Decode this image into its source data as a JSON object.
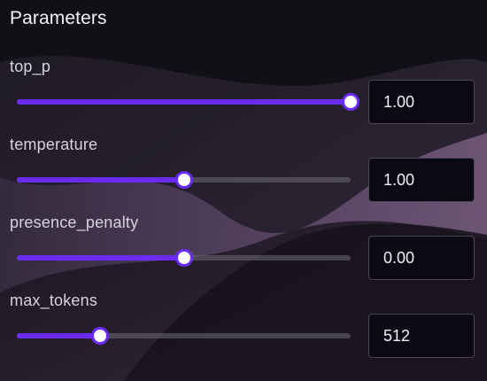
{
  "panel": {
    "title": "Parameters"
  },
  "params": [
    {
      "label": "top_p",
      "value": "1.00",
      "level": 1.0
    },
    {
      "label": "temperature",
      "value": "1.00",
      "level": 0.5
    },
    {
      "label": "presence_penalty",
      "value": "0.00",
      "level": 0.5
    },
    {
      "label": "max_tokens",
      "value": "512",
      "level": 0.25
    }
  ],
  "colors": {
    "accent": "#6a2cf5",
    "track": "#6e6978",
    "input_bg": "#0d0816"
  }
}
